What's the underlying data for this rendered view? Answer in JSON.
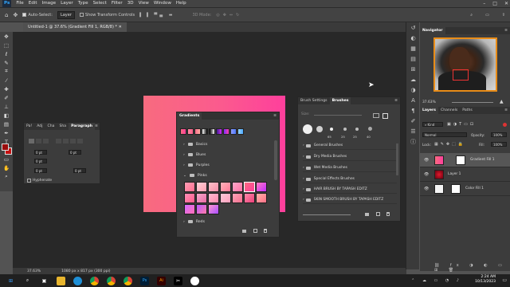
{
  "menu": {
    "items": [
      "File",
      "Edit",
      "Image",
      "Layer",
      "Type",
      "Select",
      "Filter",
      "3D",
      "View",
      "Window",
      "Help"
    ]
  },
  "options": {
    "auto_select": "Auto-Select:",
    "layer_dropdown": "Layer",
    "show_transform": "Show Transform Controls",
    "mode_3d": "3D Mode:"
  },
  "document": {
    "tab_title": "Untitled-1 @ 37.6% (Gradient Fill 1, RGB/8) *",
    "zoom": "37.63%",
    "dimensions": "1080 px x 817 px (300 ppi)"
  },
  "paragraph_panel": {
    "tabs": [
      "Pa!",
      "Adj",
      "Cha",
      "Sha",
      "Paragraph"
    ],
    "values": [
      "0 pt",
      "0 pt",
      "0 pt",
      "0 pt",
      "0 pt"
    ],
    "hyphenate": "Hyphenate"
  },
  "gradients_panel": {
    "title": "Gradients",
    "folders": [
      "Basics",
      "Blues",
      "Purples",
      "Pinks",
      "Reds"
    ]
  },
  "brushes_panel": {
    "tabs": [
      "Brush Settings",
      "Brushes"
    ],
    "size_label": "Size:",
    "brush_sizes": [
      "65",
      "25",
      "25",
      "40"
    ],
    "presets": [
      "General Brushes",
      "Dry Media Brushes",
      "Wet Media Brushes",
      "Special Effects Brushes",
      "HAIR BRUSH BY TAPASH EDITZ",
      "SKIN SMOOTH BRUSH BY TAPASH EDITZ"
    ]
  },
  "navigator": {
    "title": "Navigator",
    "zoom": "37.63%"
  },
  "layers_panel": {
    "tabs": [
      "Layers",
      "Channels",
      "Paths"
    ],
    "kind": "Kind",
    "blend_mode": "Normal",
    "opacity_label": "Opacity:",
    "opacity": "100%",
    "lock_label": "Lock:",
    "fill_label": "Fill:",
    "fill": "100%",
    "layers": [
      "Gradient Fill 1",
      "Layer 1",
      "Color Fill 1"
    ]
  },
  "taskbar": {
    "time": "2:24 AM",
    "date": "10/13/2023"
  },
  "colors": {
    "canvas_from": "#f86b7f",
    "canvas_to": "#fe3f9c",
    "foreground": "#9b0c0c",
    "background": "#c51010"
  }
}
